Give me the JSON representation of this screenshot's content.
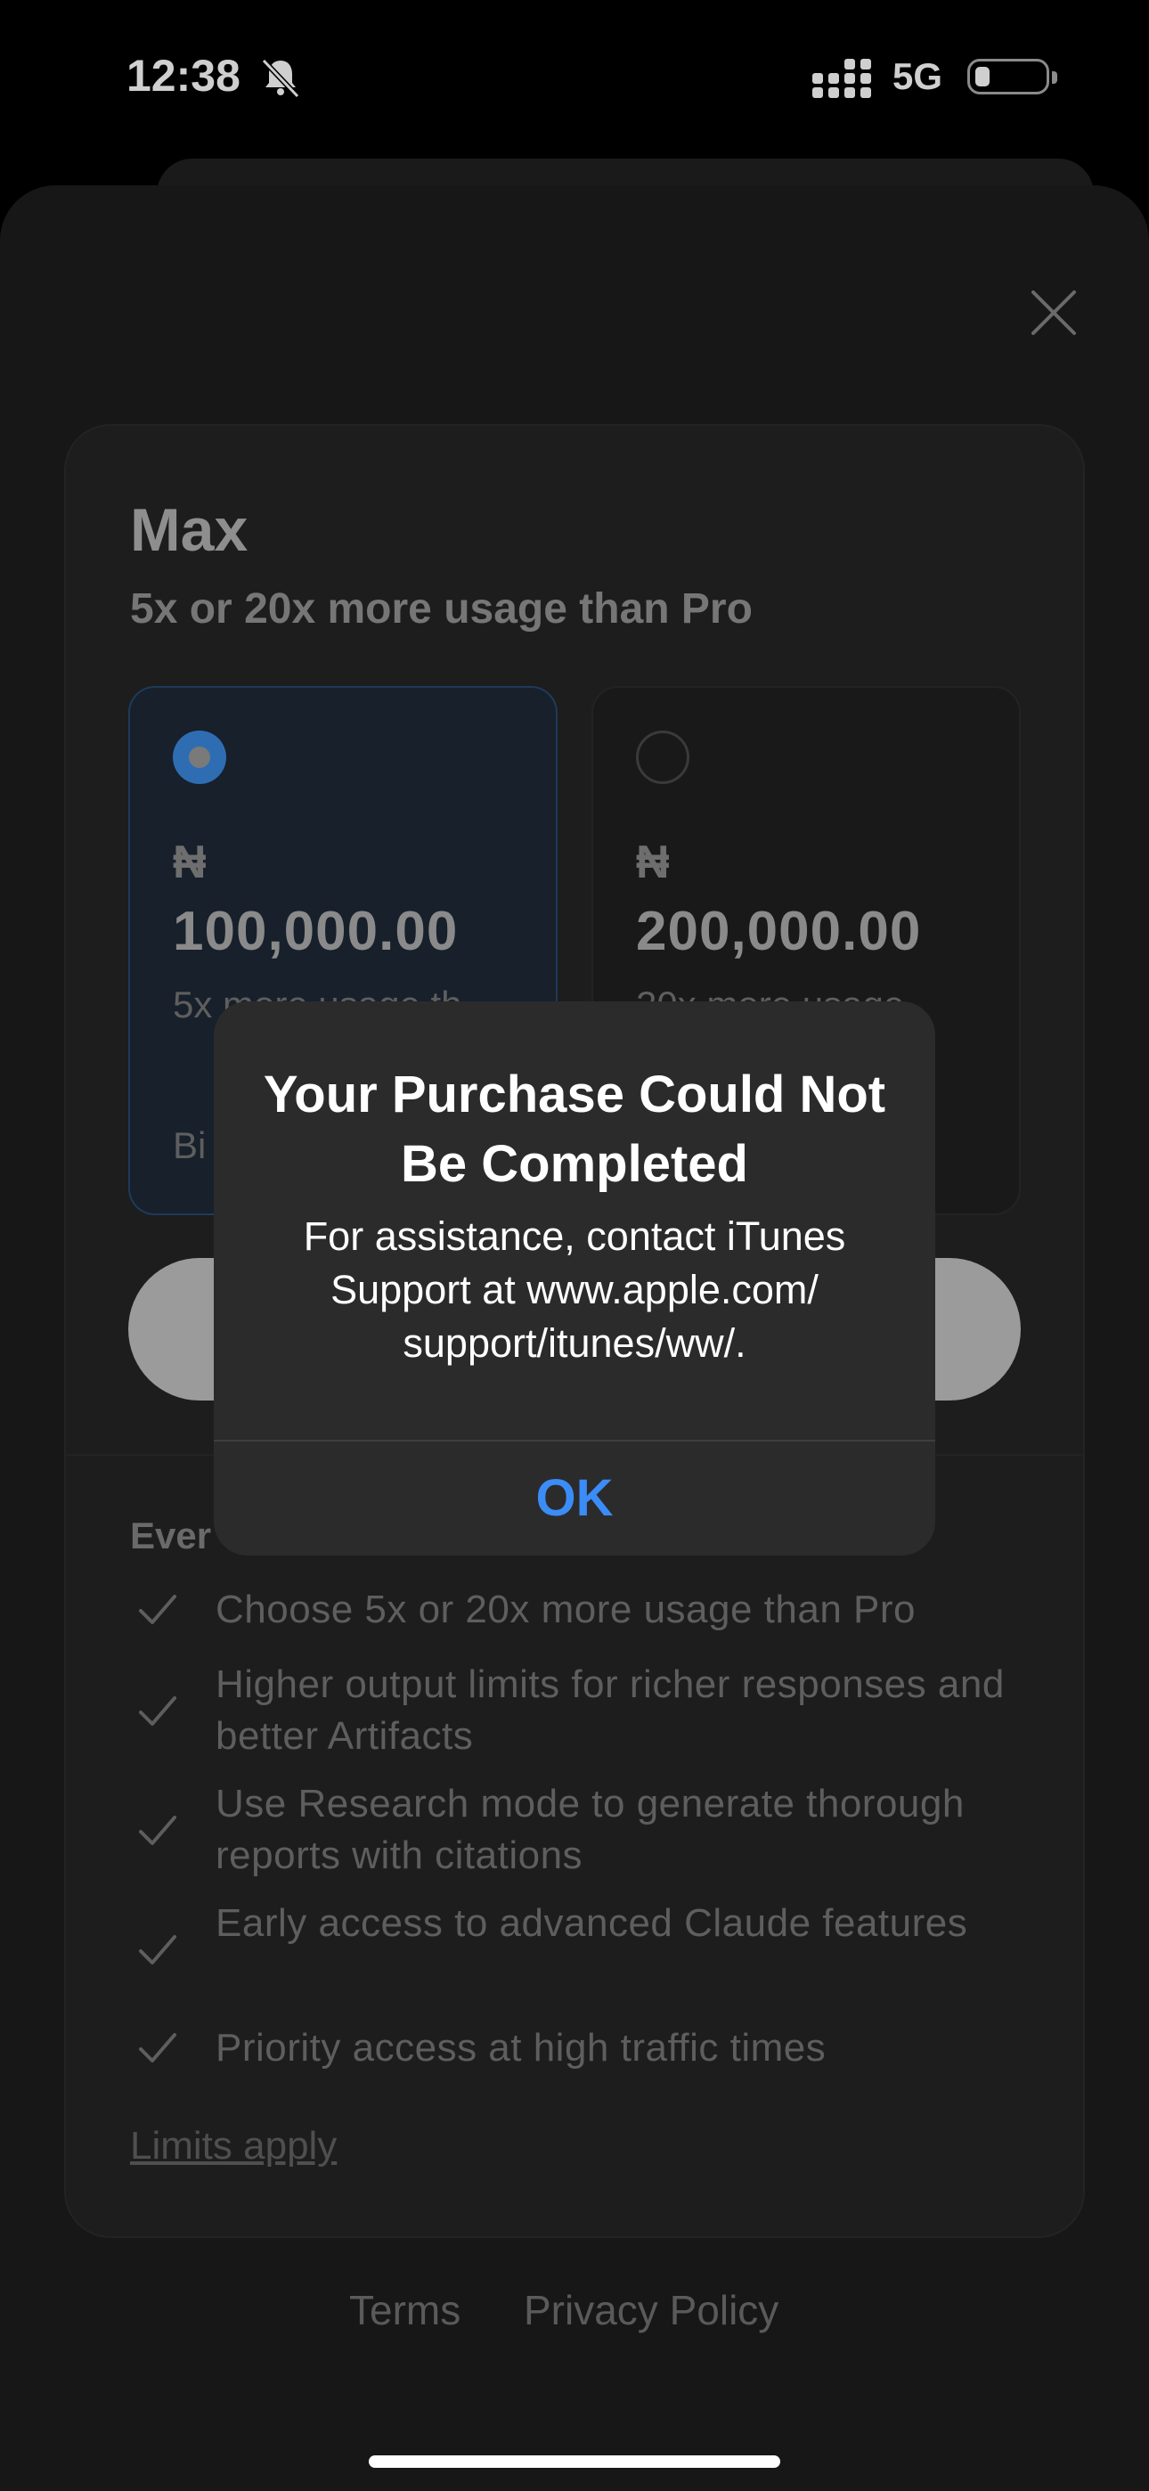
{
  "status_bar": {
    "time": "12:38",
    "network": "5G"
  },
  "plan": {
    "title": "Max",
    "subtitle": "5x or 20x more usage than Pro",
    "options": [
      {
        "currency": "₦",
        "price": "100,000.00",
        "description": "5x more usage th",
        "billed_partial": "Bi",
        "selected": true
      },
      {
        "currency": "₦",
        "price": "200,000.00",
        "description": "20x more usage",
        "selected": false
      }
    ],
    "everything_partial": "Ever",
    "features": [
      "Choose 5x or 20x more usage than Pro",
      "Higher output limits for richer responses and better Artifacts",
      "Use Research mode to generate thorough reports with citations",
      "Early access to advanced Claude features",
      "Priority access at high traffic times"
    ],
    "limits_link": "Limits apply"
  },
  "footer": {
    "terms": "Terms",
    "privacy": "Privacy Policy"
  },
  "alert": {
    "title": "Your Purchase Could Not Be Completed",
    "message": "For assistance, contact iTunes Support at www.apple.com/ support/itunes/ww/.",
    "ok": "OK"
  },
  "colors": {
    "accent": "#3b8cf6",
    "selected_card": "#17202b"
  }
}
